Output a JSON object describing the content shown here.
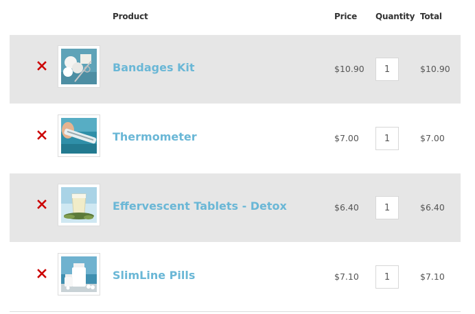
{
  "header": {
    "product": "Product",
    "price": "Price",
    "quantity": "Quantity",
    "total": "Total"
  },
  "colors": {
    "link": "#6ab7d6",
    "remove": "#cc0000",
    "row_shade": "#e6e6e6"
  },
  "items": [
    {
      "name": "Bandages Kit",
      "price": "$10.90",
      "quantity": "1",
      "total": "$10.90",
      "image_icon": "bandages-kit-image",
      "remove_icon": "remove-x-icon"
    },
    {
      "name": "Thermometer",
      "price": "$7.00",
      "quantity": "1",
      "total": "$7.00",
      "image_icon": "thermometer-image",
      "remove_icon": "remove-x-icon"
    },
    {
      "name": "Effervescent Tablets - Detox",
      "price": "$6.40",
      "quantity": "1",
      "total": "$6.40",
      "image_icon": "effervescent-tablets-image",
      "remove_icon": "remove-x-icon"
    },
    {
      "name": "SlimLine Pills",
      "price": "$7.10",
      "quantity": "1",
      "total": "$7.10",
      "image_icon": "pill-bottles-image",
      "remove_icon": "remove-x-icon"
    }
  ]
}
